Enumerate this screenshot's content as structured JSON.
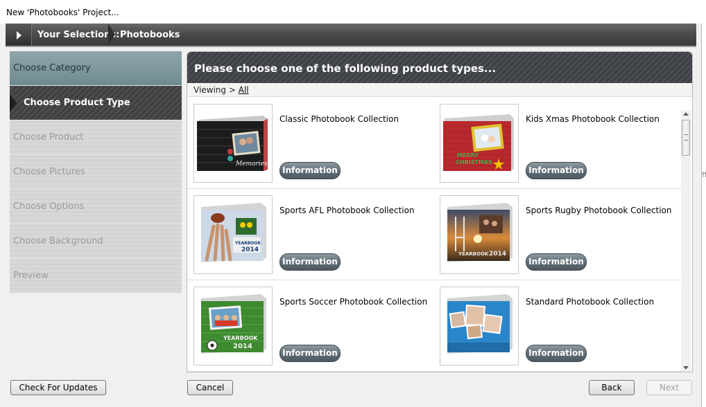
{
  "window": {
    "title": "New 'Photobooks' Project..."
  },
  "breadcrumb": {
    "label": "Your Selections:",
    "value": "Photobooks"
  },
  "steps": [
    {
      "label": "Choose Category",
      "state": "done"
    },
    {
      "label": "Choose Product Type",
      "state": "active"
    },
    {
      "label": "Choose Product",
      "state": "pending"
    },
    {
      "label": "Choose Pictures",
      "state": "pending"
    },
    {
      "label": "Choose Options",
      "state": "pending"
    },
    {
      "label": "Choose Background",
      "state": "pending"
    },
    {
      "label": "Preview",
      "state": "pending"
    }
  ],
  "main": {
    "header": "Please choose one of the following product types...",
    "viewing_label": "Viewing >",
    "viewing_link": "All"
  },
  "products": [
    {
      "name": "Classic Photobook Collection",
      "info": "Information",
      "cover_text": "Memories"
    },
    {
      "name": "Kids Xmas Photobook Collection",
      "info": "Information",
      "cover_text": "MERRY CHRISTMAS"
    },
    {
      "name": "Sports AFL Photobook Collection",
      "info": "Information",
      "cover_text": "YEARBOOK 2014"
    },
    {
      "name": "Sports Rugby Photobook Collection",
      "info": "Information",
      "cover_text": "YEARBOOK 2014"
    },
    {
      "name": "Sports Soccer Photobook Collection",
      "info": "Information",
      "cover_text": "YEARBOOK 2014"
    },
    {
      "name": "Standard Photobook Collection",
      "info": "Information",
      "cover_text": ""
    }
  ],
  "footer": {
    "check_updates": "Check For Updates",
    "cancel": "Cancel",
    "back": "Back",
    "next": "Next"
  },
  "edge_glyph": "ff",
  "colors": {
    "header_dark": "#3c3f44",
    "step_done": "#7f989e",
    "info_button": "#5f6c73"
  }
}
